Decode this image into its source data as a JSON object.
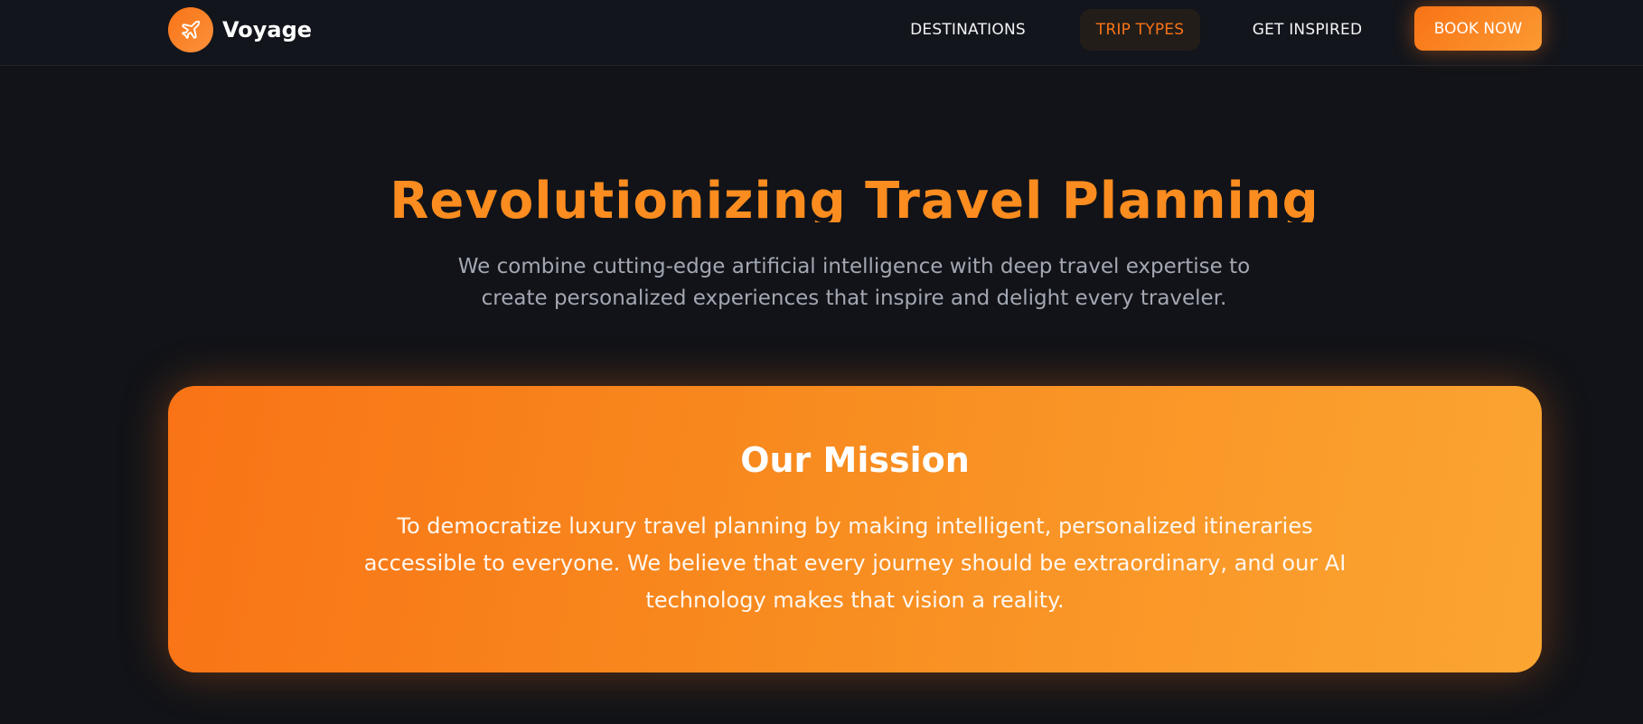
{
  "brand": {
    "name": "Voyage",
    "icon": "airplane-icon"
  },
  "nav": {
    "destinations": "DESTINATIONS",
    "trip_types": "TRIP TYPES",
    "get_inspired": "GET INSPIRED",
    "book_now": "BOOK NOW",
    "active": "trip_types"
  },
  "hero": {
    "title": "Revolutionizing Travel Planning",
    "subtitle": "We combine cutting-edge artificial intelligence with deep travel expertise to create personalized experiences that inspire and delight every traveler."
  },
  "mission": {
    "title": "Our Mission",
    "text": "To democratize luxury travel planning by making intelligent, personalized itineraries accessible to everyone. We believe that every journey should be extraordinary, and our AI technology makes that vision a reality."
  },
  "colors": {
    "accent": "#f97316",
    "accent_light": "#fba532",
    "background": "#111318"
  }
}
